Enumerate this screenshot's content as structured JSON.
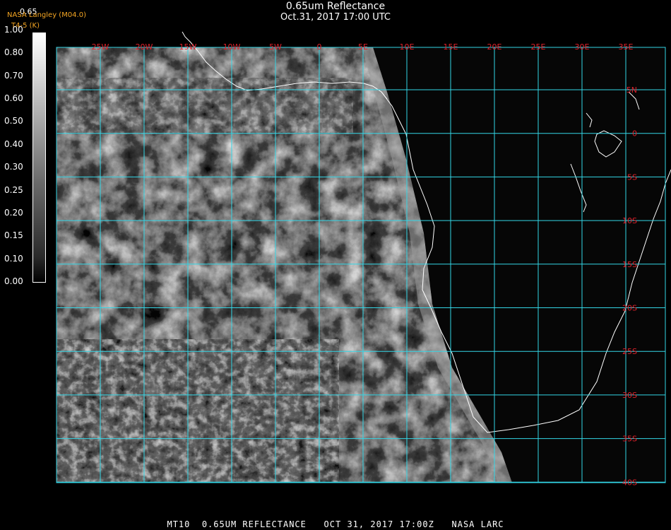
{
  "header": {
    "title": "0.65um Reflectance",
    "subtitle": "Oct.31, 2017 17:00 UTC",
    "credit": "NASA Langley (M04.0)",
    "credit2": "T4-5 (K)",
    "colorbar_top_label": "0.65"
  },
  "colorbar": {
    "labels": [
      "1.00",
      "0.80",
      "0.70",
      "0.60",
      "0.50",
      "0.40",
      "0.30",
      "0.25",
      "0.20",
      "0.15",
      "0.10",
      "0.00"
    ]
  },
  "map": {
    "lon_labels": [
      "25W",
      "20W",
      "15W",
      "10W",
      "5W",
      "0",
      "5E",
      "10E",
      "15E",
      "20E",
      "25E",
      "30E",
      "35E"
    ],
    "lat_labels": [
      "5N",
      "0",
      "5S",
      "10S",
      "15S",
      "20S",
      "25S",
      "30S",
      "35S",
      "40S"
    ],
    "colors": {
      "grid": "#33d6e6",
      "tick_label": "#e0202a",
      "coastline": "#ffffff"
    }
  },
  "footer": {
    "text": "MT10  0.65UM REFLECTANCE   OCT 31, 2017 17:00Z   NASA LARC"
  }
}
